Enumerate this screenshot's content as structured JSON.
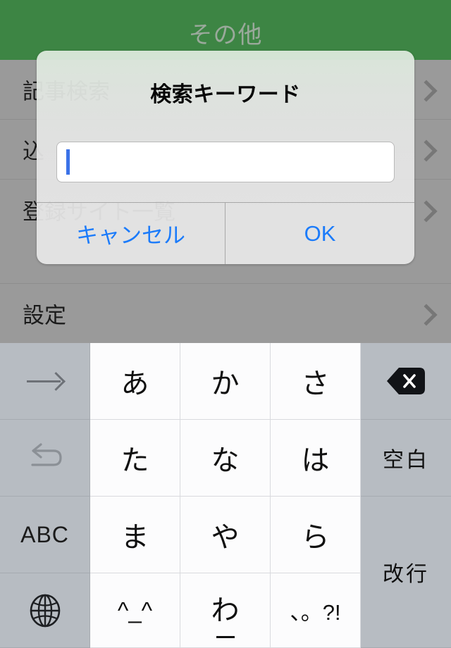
{
  "navbar": {
    "title": "その他"
  },
  "background_list": {
    "rows": [
      {
        "label": "記事検索",
        "chevron": "chevron-right-icon"
      },
      {
        "label": "込",
        "chevron": "chevron-right-icon"
      },
      {
        "label": "登録サイト一覧",
        "chevron": "chevron-right-icon"
      }
    ],
    "settings_row": {
      "label": "設定",
      "chevron": "chevron-right-icon"
    }
  },
  "dialog": {
    "title": "検索キーワード",
    "input": {
      "value": "",
      "placeholder": ""
    },
    "cancel_label": "キャンセル",
    "ok_label": "OK",
    "accent_color": "#1b7bfa",
    "caret_color": "#3b72e8"
  },
  "keyboard": {
    "rows": [
      [
        {
          "name": "key-next-candidate",
          "label": "",
          "icon": "arrow-right-icon",
          "style": "dark"
        },
        {
          "name": "key-a",
          "label": "あ",
          "style": "light"
        },
        {
          "name": "key-ka",
          "label": "か",
          "style": "light"
        },
        {
          "name": "key-sa",
          "label": "さ",
          "style": "light"
        },
        {
          "name": "key-delete",
          "label": "",
          "icon": "delete-icon",
          "style": "dark"
        }
      ],
      [
        {
          "name": "key-undo",
          "label": "",
          "icon": "undo-icon",
          "style": "dark"
        },
        {
          "name": "key-ta",
          "label": "た",
          "style": "light"
        },
        {
          "name": "key-na",
          "label": "な",
          "style": "light"
        },
        {
          "name": "key-ha",
          "label": "は",
          "style": "light"
        },
        {
          "name": "key-space",
          "label": "空白",
          "style": "dark"
        }
      ],
      [
        {
          "name": "key-abc",
          "label": "ABC",
          "style": "dark"
        },
        {
          "name": "key-ma",
          "label": "ま",
          "style": "light"
        },
        {
          "name": "key-ya",
          "label": "や",
          "style": "light"
        },
        {
          "name": "key-ra",
          "label": "ら",
          "style": "light"
        },
        {
          "name": "key-return",
          "label": "改行",
          "style": "dark"
        }
      ],
      [
        {
          "name": "key-globe",
          "label": "",
          "icon": "globe-icon",
          "style": "dark"
        },
        {
          "name": "key-kaomoji",
          "label": "^_^",
          "style": "light"
        },
        {
          "name": "key-wa",
          "label": "わ",
          "style": "light"
        },
        {
          "name": "key-punctuation",
          "label": "、。?!",
          "style": "light"
        }
      ]
    ],
    "key_labels": {
      "arrow_right": "→",
      "a": "あ",
      "ka": "か",
      "sa": "さ",
      "ta": "た",
      "na": "な",
      "ha": "は",
      "ma": "ま",
      "ya": "や",
      "ra": "ら",
      "wa": "わ",
      "kaomoji": "^_^",
      "punctuation": "、。?!",
      "space": "空白",
      "return": "改行",
      "abc": "ABC"
    },
    "colors": {
      "key_light": "#fcfcfd",
      "key_dark": "#b7bcc2",
      "key_text": "#101010"
    }
  }
}
